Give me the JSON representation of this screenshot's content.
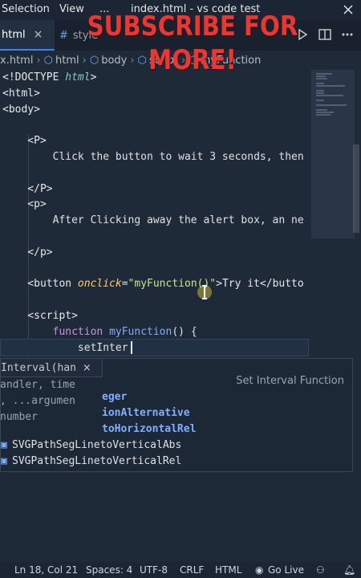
{
  "titlebar": {
    "menu": [
      "Selection",
      "View",
      "..."
    ],
    "title": "index.html - vs code test"
  },
  "promo": {
    "line1": "SUBSCRIBE FOR",
    "line2": "MORE!"
  },
  "tabs": [
    {
      "label": "html",
      "close": "×"
    },
    {
      "label": "style"
    }
  ],
  "breadcrumb": [
    "x.html",
    "html",
    "body",
    "script",
    "myFunction"
  ],
  "editor": {
    "lines": [
      {
        "parts": [
          [
            "tag",
            "<!"
          ],
          [
            "tag",
            "DOCTYPE "
          ],
          [
            "kw-i",
            "html"
          ],
          [
            "tag",
            ">"
          ]
        ]
      },
      {
        "parts": [
          [
            "tag",
            "<html>"
          ]
        ]
      },
      {
        "parts": [
          [
            "tag",
            "<body>"
          ]
        ]
      },
      {
        "parts": []
      },
      {
        "parts": [
          [
            "tag",
            "    <P>"
          ]
        ]
      },
      {
        "parts": [
          [
            "txt",
            "        Click the button to wait 3 seconds, then"
          ]
        ]
      },
      {
        "parts": []
      },
      {
        "parts": [
          [
            "tag",
            "    </P>"
          ]
        ]
      },
      {
        "parts": [
          [
            "tag",
            "    <p>"
          ]
        ]
      },
      {
        "parts": [
          [
            "txt",
            "        After Clicking away the alert box, an ne"
          ]
        ]
      },
      {
        "parts": []
      },
      {
        "parts": [
          [
            "tag",
            "    </p>"
          ]
        ]
      },
      {
        "parts": []
      },
      {
        "parts": [
          [
            "tag",
            "    <button "
          ],
          [
            "attr",
            "onclick"
          ],
          [
            "tag",
            "="
          ],
          [
            "str",
            "\"myFunction()\""
          ],
          [
            "tag",
            ">Try it</butto"
          ]
        ]
      },
      {
        "parts": []
      },
      {
        "parts": [
          [
            "tag",
            "    <script>"
          ]
        ]
      },
      {
        "parts": [
          [
            "kw",
            "        function "
          ],
          [
            "fn",
            "myFunction"
          ],
          [
            "txt",
            "() {"
          ]
        ]
      },
      {
        "parts": [
          [
            "txt",
            "            setInter"
          ]
        ]
      }
    ]
  },
  "param_hint": {
    "signature": "Interval(han",
    "close": "×",
    "docs": [
      "andler, time",
      ", ...argumen",
      "number"
    ]
  },
  "suggest": {
    "detail": "Set Interval Function",
    "items": [
      {
        "icon": "",
        "pre": "",
        "hl": "eger",
        "post": ""
      },
      {
        "icon": "",
        "pre": "",
        "hl": "ionAlternative",
        "post": ""
      },
      {
        "icon": "",
        "pre": "",
        "hl": "toHorizontalRel",
        "post": ""
      },
      {
        "icon": "[]",
        "pre": "SVGPathSegLinetoVerticalAbs",
        "hl": "",
        "post": ""
      },
      {
        "icon": "[]",
        "pre": "SVGPathSegLinetoVerticalRel",
        "hl": "",
        "post": ""
      }
    ]
  },
  "statusbar": {
    "position": "Ln 18, Col 21",
    "spaces": "Spaces: 4",
    "encoding": "UTF-8",
    "eol": "CRLF",
    "language": "HTML",
    "golive": "Go Live"
  },
  "colors": {
    "accent": "#3b82f6",
    "promo": "#e53935"
  }
}
